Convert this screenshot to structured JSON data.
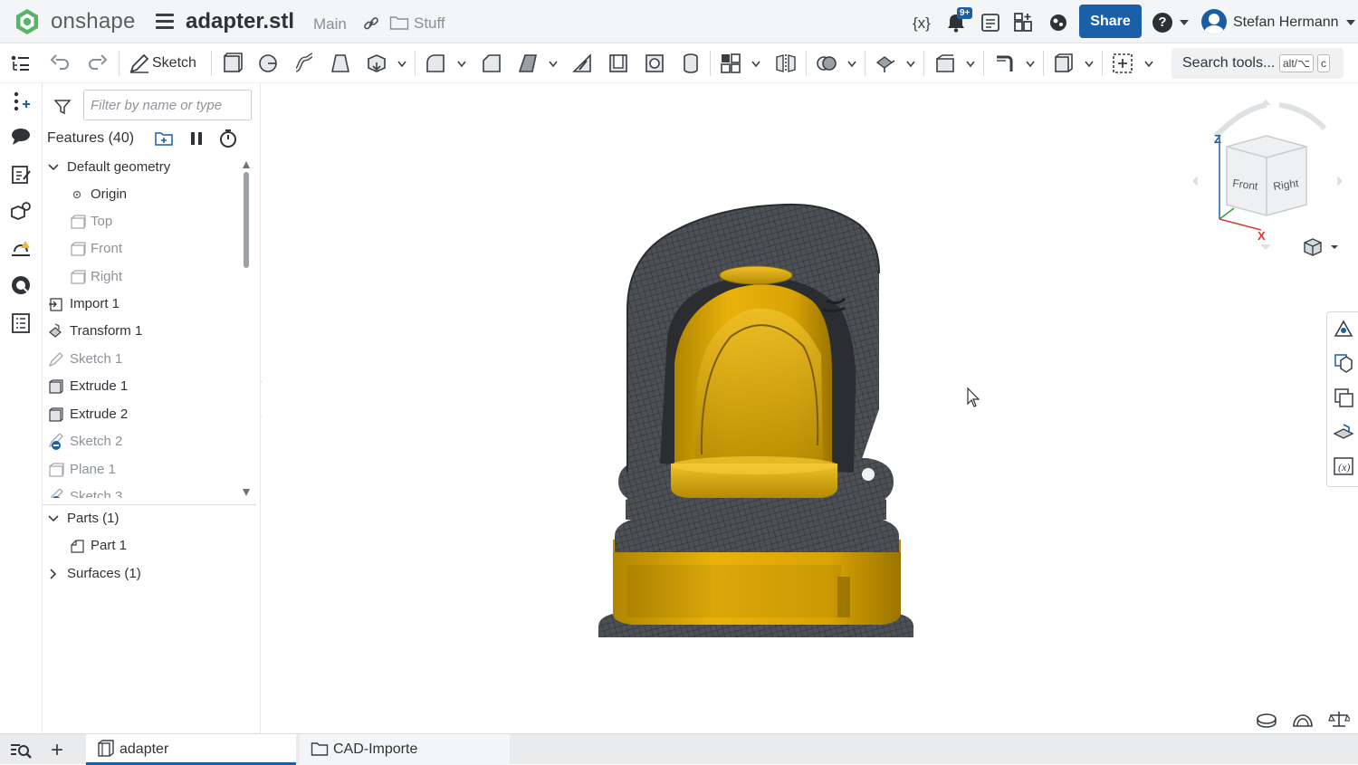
{
  "app": {
    "brand": "onshape",
    "document_name": "adapter.stl",
    "branch": "Main",
    "folder": "Stuff",
    "notification_badge": "9+",
    "share_label": "Share",
    "help_label": "?",
    "user_name": "Stefan Hermann",
    "brand_color": "#1c5fa9"
  },
  "toolbar": {
    "sketch_label": "Sketch",
    "search_label": "Search tools...",
    "search_shortcut_1": "alt/⌥",
    "search_shortcut_2": "c",
    "icons": [
      "undo-icon",
      "redo-icon",
      "sketch-icon",
      "extrude-icon",
      "revolve-icon",
      "sweep-icon",
      "loft-icon",
      "thicken-icon",
      "fillet-icon",
      "chamfer-icon",
      "draft-icon",
      "rib-icon",
      "shell-icon",
      "hole-icon",
      "cylinder-icon",
      "pattern-icon",
      "mirror-icon",
      "boolean-icon",
      "transform-icon",
      "plane-icon",
      "sheetmetal-icon",
      "frame-icon",
      "select-icon"
    ]
  },
  "panel": {
    "filter_placeholder": "Filter by name or type",
    "features_heading": "Features (40)",
    "tree": [
      {
        "label": "Default geometry",
        "type": "group",
        "expanded": true
      },
      {
        "label": "Origin",
        "type": "origin"
      },
      {
        "label": "Top",
        "type": "plane",
        "dim": true
      },
      {
        "label": "Front",
        "type": "plane",
        "dim": true
      },
      {
        "label": "Right",
        "type": "plane",
        "dim": true
      },
      {
        "label": "Import 1",
        "type": "import"
      },
      {
        "label": "Transform 1",
        "type": "transform"
      },
      {
        "label": "Sketch 1",
        "type": "sketch",
        "dim": true
      },
      {
        "label": "Extrude 1",
        "type": "extrude"
      },
      {
        "label": "Extrude 2",
        "type": "extrude"
      },
      {
        "label": "Sketch 2",
        "type": "sketch-error",
        "dim": true
      },
      {
        "label": "Plane 1",
        "type": "plane",
        "dim": true
      },
      {
        "label": "Sketch 3",
        "type": "sketch-error",
        "dim": true
      }
    ],
    "parts": [
      {
        "label": "Parts (1)",
        "type": "group",
        "expanded": true
      },
      {
        "label": "Part 1",
        "type": "part"
      },
      {
        "label": "Surfaces (1)",
        "type": "group",
        "expanded": false
      }
    ]
  },
  "viewcube": {
    "front_label": "Front",
    "right_label": "Right",
    "axis_z": "Z",
    "axis_x": "X"
  },
  "tabs": [
    {
      "label": "adapter",
      "active": true
    },
    {
      "label": "CAD-Importe",
      "active": false
    }
  ]
}
